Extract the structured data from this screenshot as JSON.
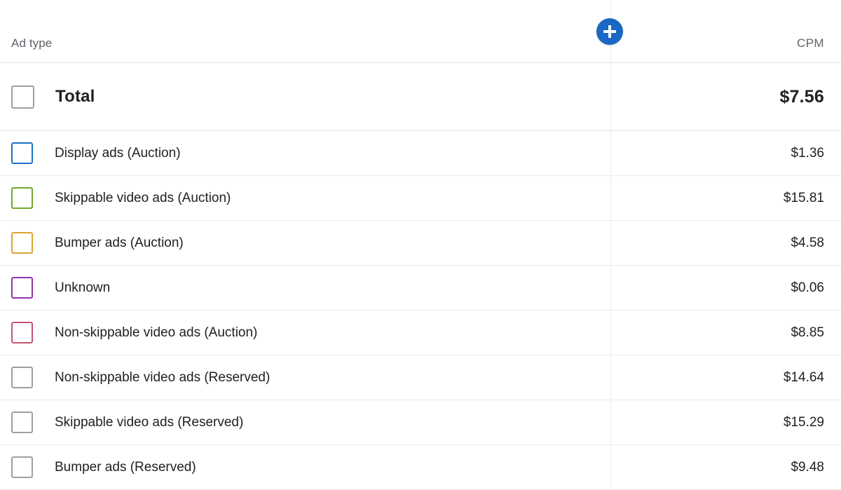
{
  "header": {
    "dimension_label": "Ad type",
    "metric_label": "CPM",
    "add_button_icon": "plus-icon",
    "add_button_color": "#1a67c4"
  },
  "total_row": {
    "label": "Total",
    "value": "$7.56",
    "checkbox_color": "#9aa0a6"
  },
  "rows": [
    {
      "label": "Display ads (Auction)",
      "value": "$1.36",
      "checkbox_color": "#1a73c8"
    },
    {
      "label": "Skippable video ads (Auction)",
      "value": "$15.81",
      "checkbox_color": "#6fa82c"
    },
    {
      "label": "Bumper ads (Auction)",
      "value": "$4.58",
      "checkbox_color": "#dda32e"
    },
    {
      "label": "Unknown",
      "value": "$0.06",
      "checkbox_color": "#9134ab"
    },
    {
      "label": "Non-skippable video ads (Auction)",
      "value": "$8.85",
      "checkbox_color": "#c2556f"
    },
    {
      "label": "Non-skippable video ads (Reserved)",
      "value": "$14.64",
      "checkbox_color": "#9aa0a6"
    },
    {
      "label": "Skippable video ads (Reserved)",
      "value": "$15.29",
      "checkbox_color": "#9aa0a6"
    },
    {
      "label": "Bumper ads (Reserved)",
      "value": "$9.48",
      "checkbox_color": "#9aa0a6"
    }
  ],
  "chart_data": {
    "type": "table",
    "title": "",
    "columns": [
      "Ad type",
      "CPM"
    ],
    "categories": [
      "Total",
      "Display ads (Auction)",
      "Skippable video ads (Auction)",
      "Bumper ads (Auction)",
      "Unknown",
      "Non-skippable video ads (Auction)",
      "Non-skippable video ads (Reserved)",
      "Skippable video ads (Reserved)",
      "Bumper ads (Reserved)"
    ],
    "values": [
      7.56,
      1.36,
      15.81,
      4.58,
      0.06,
      8.85,
      14.64,
      15.29,
      9.48
    ],
    "xlabel": "Ad type",
    "ylabel": "CPM"
  }
}
